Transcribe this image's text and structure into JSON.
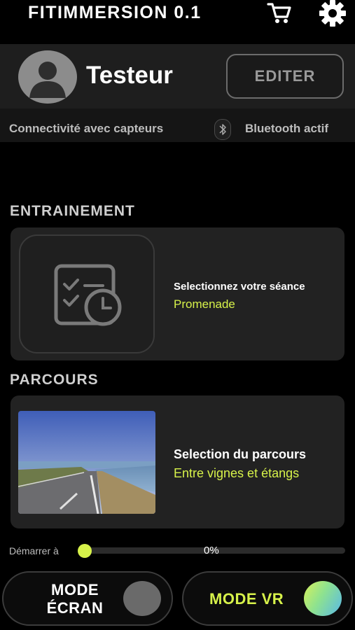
{
  "header": {
    "app_title": "FITIMMERSION 0.1",
    "cart_icon": "cart-icon",
    "settings_icon": "gear-icon"
  },
  "profile": {
    "avatar_icon": "user-avatar-icon",
    "username": "Testeur",
    "edit_label": "EDITER"
  },
  "connectivity": {
    "label": "Connectivité avec capteurs",
    "icon": "bluetooth-icon",
    "status": "Bluetooth actif"
  },
  "training": {
    "section_title": "ENTRAINEMENT",
    "icon": "checklist-clock-icon",
    "prompt": "Selectionnez votre séance",
    "value": "Promenade"
  },
  "route": {
    "section_title": "PARCOURS",
    "prompt": "Selection du parcours",
    "value": "Entre vignes et étangs"
  },
  "start": {
    "label": "Démarrer à",
    "value_text": "0%",
    "value": 0
  },
  "modes": {
    "screen_label_line1": "MODE",
    "screen_label_line2": "ÉCRAN",
    "vr_label": "MODE VR",
    "screen_on": false,
    "vr_on": true
  },
  "colors": {
    "accent": "#d7f24a",
    "background": "#000000",
    "card": "#222222"
  }
}
